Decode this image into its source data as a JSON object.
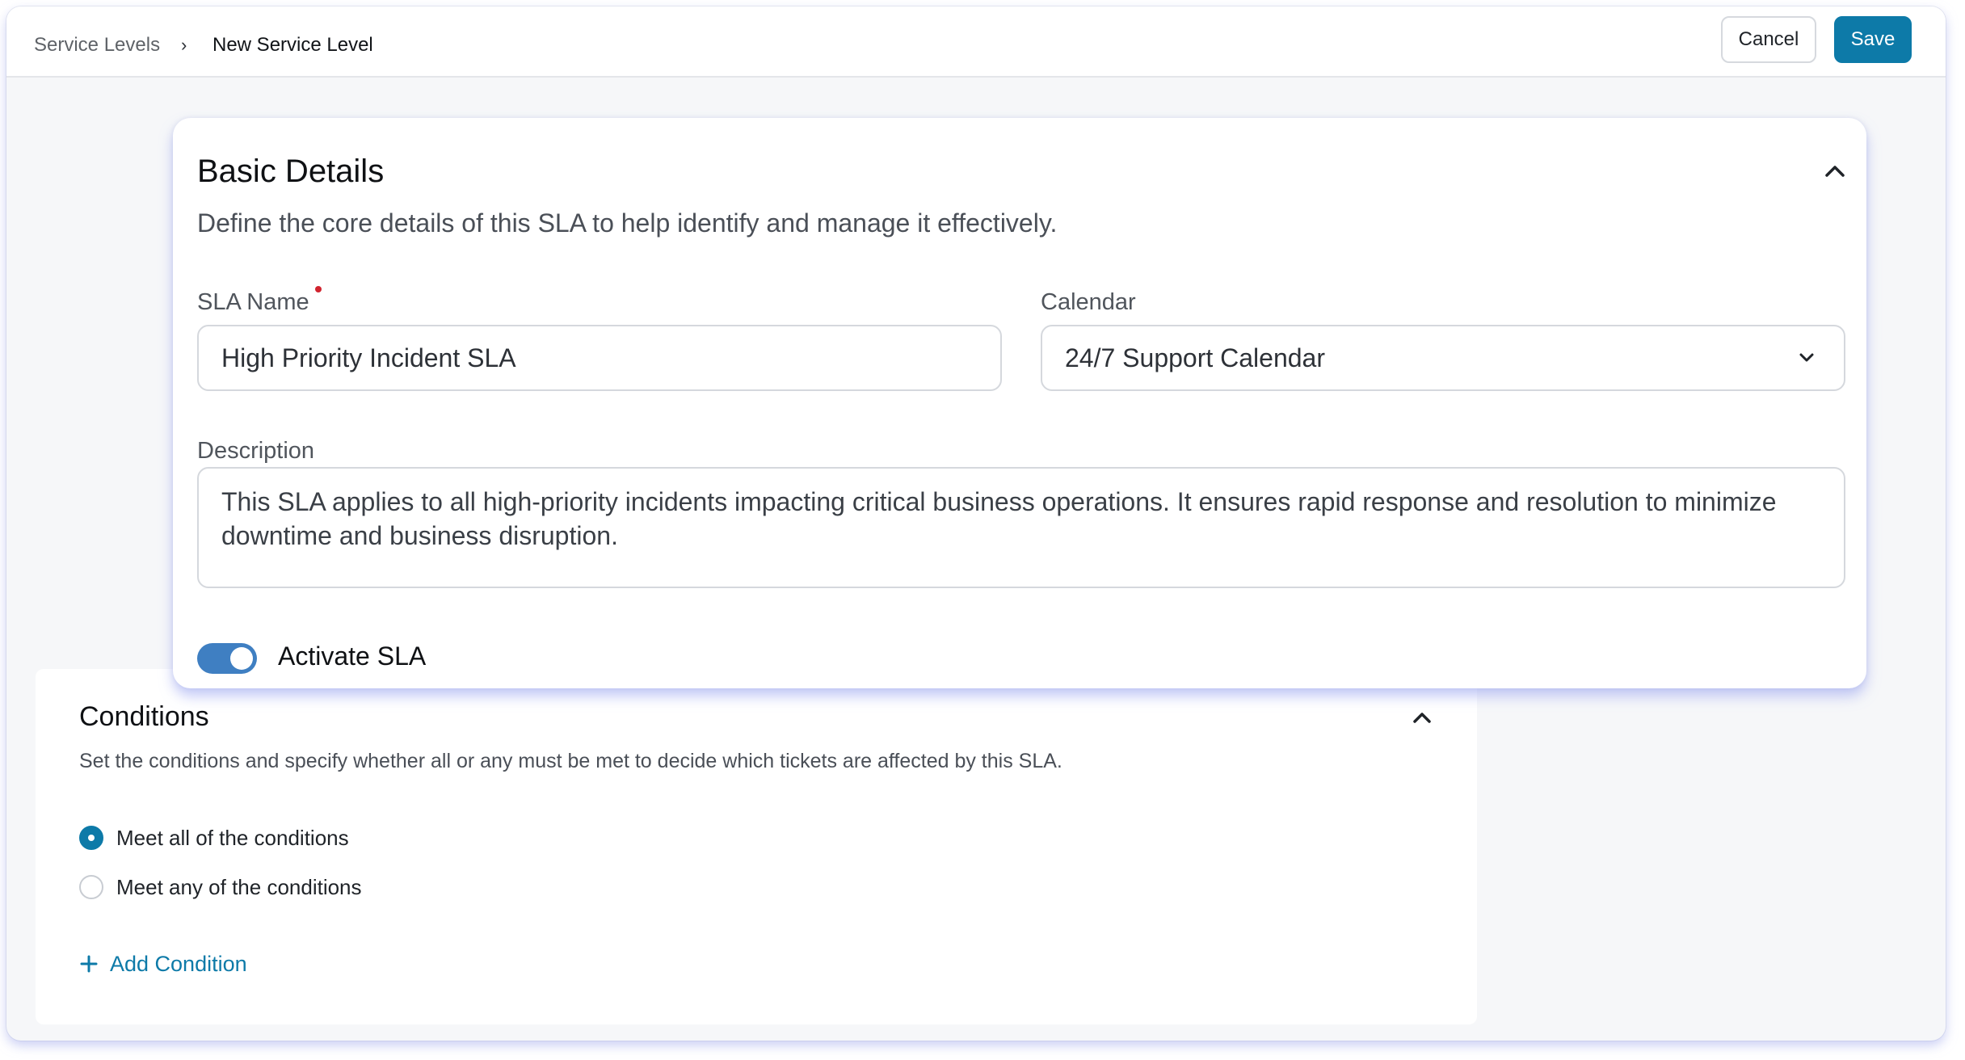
{
  "header": {
    "breadcrumb_root": "Service Levels",
    "breadcrumb_separator": "›",
    "breadcrumb_current": "New Service Level",
    "cancel_label": "Cancel",
    "save_label": "Save"
  },
  "basic_details": {
    "title": "Basic Details",
    "subtitle": "Define the core details of this SLA to help identify and manage it effectively.",
    "sla_name_label": "SLA Name",
    "sla_name_value": "High Priority Incident SLA",
    "calendar_label": "Calendar",
    "calendar_value": "24/7 Support Calendar",
    "description_label": "Description",
    "description_value": "This SLA applies to all high-priority incidents impacting critical business operations. It ensures rapid response and resolution to minimize downtime and business disruption.",
    "activate_label": "Activate SLA",
    "activate_on": true
  },
  "conditions": {
    "title": "Conditions",
    "subtitle": "Set the conditions and specify whether all or any must be met to decide which tickets are affected by this SLA.",
    "option_all": "Meet all of the conditions",
    "option_any": "Meet any of the conditions",
    "selected": "all",
    "add_label": "Add Condition"
  },
  "colors": {
    "accent": "#0d7aa8",
    "toggle": "#3f7fc2",
    "required": "#d1242f"
  }
}
